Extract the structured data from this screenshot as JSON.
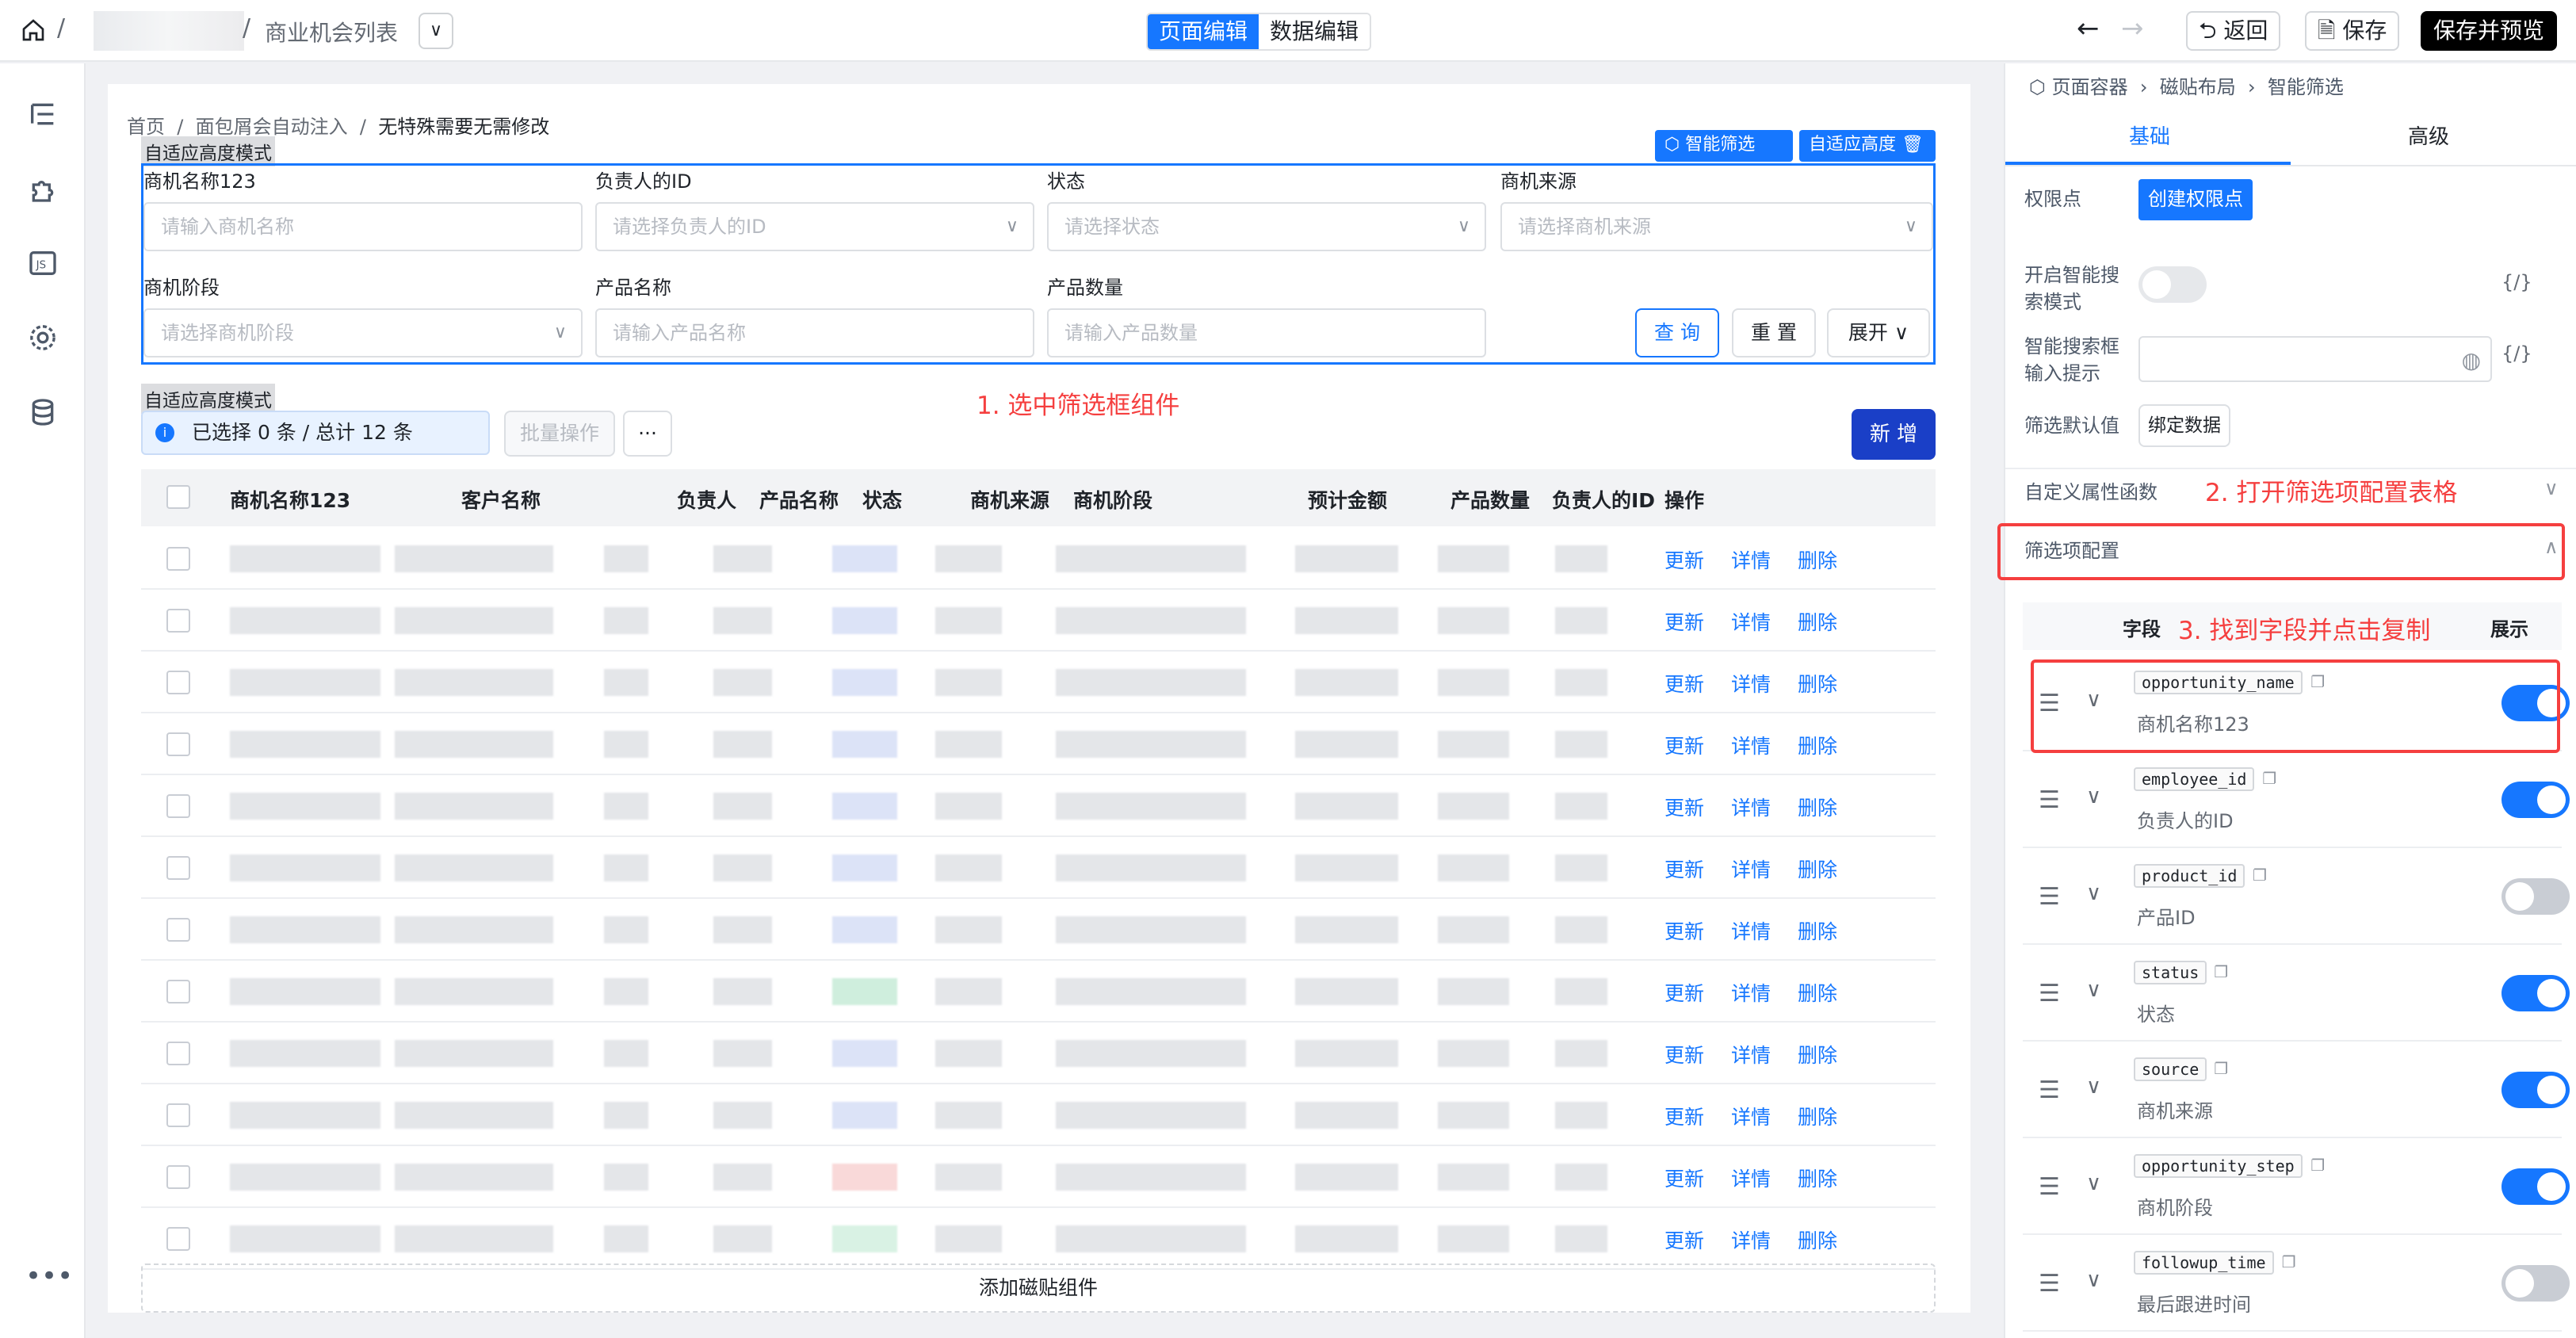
{
  "topbar": {
    "crumb_sep": "/",
    "page_title": "商业机会列表",
    "dropdown": "∨",
    "mode_tabs": [
      "页面编辑",
      "数据编辑"
    ],
    "back": "返回",
    "save": "保存",
    "save_preview": "保存并预览",
    "undo": "←",
    "redo": "→"
  },
  "canvas": {
    "breadcrumb": [
      "首页",
      "面包屑会自动注入",
      "无特殊需要无需修改"
    ],
    "adaptive_tag": "自适应高度模式",
    "smart_filter_btn": "智能筛选",
    "adaptive_btn": "自适应高度",
    "filters": [
      {
        "label": "商机名称123",
        "placeholder": "请输入商机名称",
        "select": false
      },
      {
        "label": "负责人的ID",
        "placeholder": "请选择负责人的ID",
        "select": true
      },
      {
        "label": "状态",
        "placeholder": "请选择状态",
        "select": true
      },
      {
        "label": "商机来源",
        "placeholder": "请选择商机来源",
        "select": true
      },
      {
        "label": "商机阶段",
        "placeholder": "请选择商机阶段",
        "select": true
      },
      {
        "label": "产品名称",
        "placeholder": "请输入产品名称",
        "select": false
      },
      {
        "label": "产品数量",
        "placeholder": "请输入产品数量",
        "select": false
      }
    ],
    "query": "查 询",
    "reset": "重 置",
    "expand": "展开",
    "annotation1": "1. 选中筛选框组件",
    "selection_info": "已选择 0 条 / 总计 12 条",
    "batch": "批量操作",
    "more": "···",
    "add": "新 增",
    "columns": [
      "商机名称123",
      "客户名称",
      "负责人",
      "产品名称",
      "状态",
      "商机来源",
      "商机阶段",
      "预计金额",
      "产品数量",
      "负责人的ID",
      "操作"
    ],
    "actions": [
      "更新",
      "详情",
      "删除"
    ],
    "row_count": 12,
    "add_magnet": "添加磁贴组件"
  },
  "panel": {
    "breadcrumb": [
      "页面容器",
      "磁贴布局",
      "智能筛选"
    ],
    "tabs": [
      "基础",
      "高级"
    ],
    "perm_label": "权限点",
    "perm_btn": "创建权限点",
    "smart_search_label": "开启智能搜索模式",
    "smart_hint_label": "智能搜索框输入提示",
    "default_label": "筛选默认值",
    "bind_btn": "绑定数据",
    "code_icon": "{/}",
    "custom_func": "自定义属性函数",
    "annotation2": "2. 打开筛选项配置表格",
    "filter_config": "筛选项配置",
    "col_field": "字段",
    "annotation3": "3. 找到字段并点击复制",
    "col_show": "展示",
    "fields": [
      {
        "code": "opportunity_name",
        "label": "商机名称123",
        "on": true
      },
      {
        "code": "employee_id",
        "label": "负责人的ID",
        "on": true
      },
      {
        "code": "product_id",
        "label": "产品ID",
        "on": false
      },
      {
        "code": "status",
        "label": "状态",
        "on": true
      },
      {
        "code": "source",
        "label": "商机来源",
        "on": true
      },
      {
        "code": "opportunity_step",
        "label": "商机阶段",
        "on": true
      },
      {
        "code": "followup_time",
        "label": "最后跟进时间",
        "on": false
      }
    ]
  }
}
